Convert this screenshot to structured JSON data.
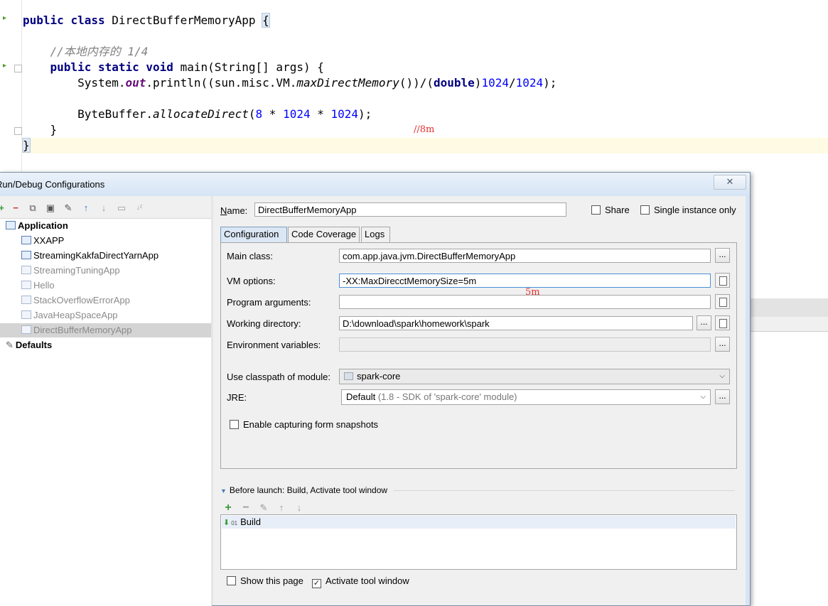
{
  "editor": {
    "code": {
      "l1_kw1": "public",
      "l1_kw2": "class",
      "l1_name": " DirectBufferMemoryApp ",
      "l1_brace": "{",
      "l3_comment": "//本地内存的 1/4",
      "l4_kw1": "public",
      "l4_kw2": "static",
      "l4_kw3": "void",
      "l4_rest": " main(String[] args) {",
      "l5_a": "System.",
      "l5_out": "out",
      "l5_b": ".println((sun.misc.VM.",
      "l5_method": "maxDirectMemory",
      "l5_c": "())/(",
      "l5_double": "double",
      "l5_d": ")",
      "l5_n1": "1024",
      "l5_slash": "/",
      "l5_n2": "1024",
      "l5_end": ");",
      "l7_a": "ByteBuffer.",
      "l7_method": "allocateDirect",
      "l7_b": "(",
      "l7_n1": "8",
      "l7_op1": " * ",
      "l7_n2": "1024",
      "l7_op2": " * ",
      "l7_n3": "1024",
      "l7_end": ");",
      "l8": "}",
      "l9": "}"
    },
    "annotation_8m": "//8m",
    "annotation_5m": "5m"
  },
  "dialog": {
    "title": "Run/Debug Configurations",
    "close_glyph": "✕",
    "tree": {
      "application_label": "Application",
      "items": [
        "XXAPP",
        "StreamingKakfaDirectYarnApp",
        "StreamingTuningApp",
        "Hello",
        "StackOverflowErrorApp",
        "JavaHeapSpaceApp",
        "DirectBufferMemoryApp"
      ],
      "defaults_label": "Defaults"
    },
    "name_label": "Name:",
    "name_value": "DirectBufferMemoryApp",
    "share_label": "Share",
    "single_instance_label": "Single instance only",
    "tabs": [
      "Configuration",
      "Code Coverage",
      "Logs"
    ],
    "config": {
      "main_class_label": "Main class:",
      "main_class_value": "com.app.java.jvm.DirectBufferMemoryApp",
      "vm_options_label": "VM options:",
      "vm_options_value": "-XX:MaxDirecctMemorySize=5m",
      "program_args_label": "Program arguments:",
      "program_args_value": "",
      "working_dir_label": "Working directory:",
      "working_dir_value": "D:\\download\\spark\\homework\\spark",
      "env_vars_label": "Environment variables:",
      "env_vars_value": "",
      "classpath_label": "Use classpath of module:",
      "classpath_value": "spark-core",
      "jre_label": "JRE:",
      "jre_default": "Default",
      "jre_detail": " (1.8 - SDK of 'spark-core' module)",
      "snapshots_label": "Enable capturing form snapshots",
      "dots": "..."
    },
    "before_launch": {
      "header": "Before launch: Build, Activate tool window",
      "item": "Build",
      "show_page_label": "Show this page",
      "show_page_checked": false,
      "activate_tool_label": "Activate tool window",
      "activate_tool_checked": true
    }
  }
}
